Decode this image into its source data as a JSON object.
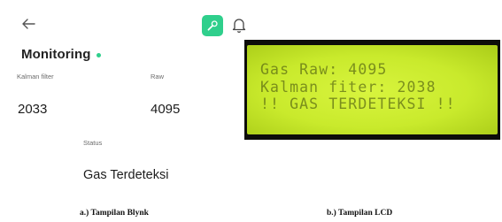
{
  "blynk": {
    "title": "Monitoring",
    "kalman_label": "Kalman filter",
    "kalman_value": "2033",
    "raw_label": "Raw",
    "raw_value": "4095",
    "status_label": "Status",
    "status_value": "Gas Terdeteksi",
    "accent_color": "#2fcf8c",
    "online_color": "#2fcf8c",
    "icons": [
      "back-arrow-icon",
      "wrench-icon",
      "bell-icon"
    ]
  },
  "lcd": {
    "line1": "Gas Raw: 4095",
    "line2": "Kalman fiter: 2038",
    "line3": "!! GAS TERDETEKSI !!",
    "screen_color": "#cdeb30",
    "text_color": "#5a6a14"
  },
  "captions": {
    "left": "a.) Tampilan Blynk",
    "right": "b.) Tampilan LCD"
  }
}
